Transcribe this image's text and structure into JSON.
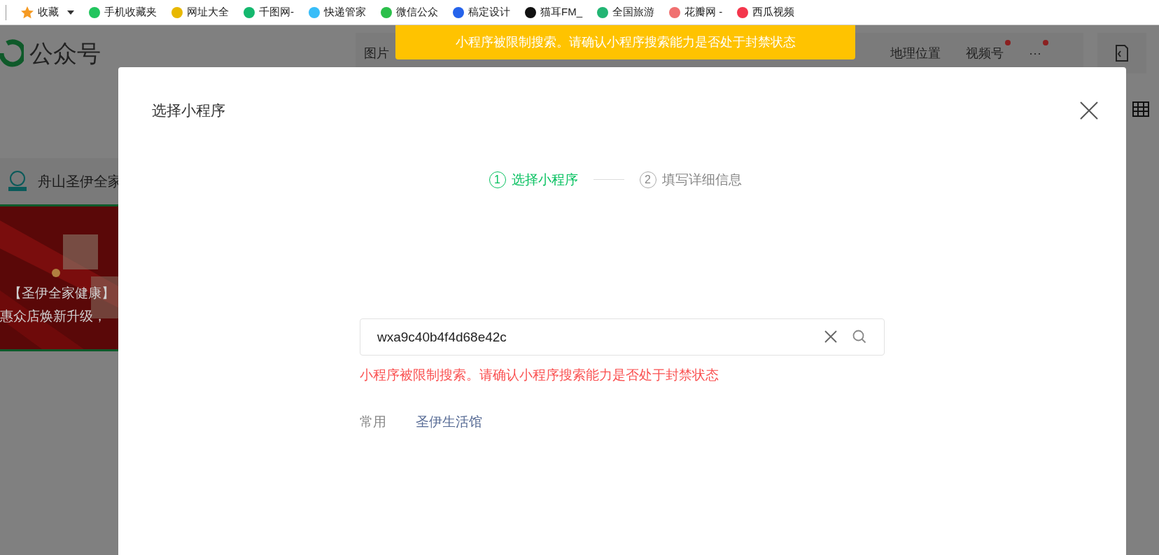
{
  "bookmarks": [
    {
      "label": "收藏",
      "color": "#f59a23"
    },
    {
      "label": "手机收藏夹",
      "color": "#22c55e"
    },
    {
      "label": "网址大全",
      "color": "#e8b800"
    },
    {
      "label": "千图网-",
      "color": "#14b86e"
    },
    {
      "label": "快递管家",
      "color": "#38bdf8"
    },
    {
      "label": "微信公众",
      "color": "#2bbf4a"
    },
    {
      "label": "稿定设计",
      "color": "#2563eb"
    },
    {
      "label": "猫耳FM_",
      "color": "#111111"
    },
    {
      "label": "全国旅游",
      "color": "#22b573"
    },
    {
      "label": "花瓣网 -",
      "color": "#f07070"
    },
    {
      "label": "西瓜视频",
      "color": "#f4364c"
    }
  ],
  "page": {
    "brand": "公众号",
    "nav": [
      "图片",
      "地理位置",
      "视频号",
      "···"
    ],
    "account": "舟山圣伊全家",
    "banner_lines": [
      "【圣伊全家健康】",
      "惠众店焕新升级，"
    ]
  },
  "toast": "小程序被限制搜索。请确认小程序搜索能力是否处于封禁状态",
  "dialog": {
    "title": "选择小程序",
    "steps": [
      {
        "number": "1",
        "label": "选择小程序",
        "selected": true
      },
      {
        "number": "2",
        "label": "填写详细信息",
        "selected": false
      }
    ],
    "search": {
      "value": "wxa9c40b4f4d68e42c"
    },
    "error": "小程序被限制搜索。请确认小程序搜索能力是否处于封禁状态",
    "recent": {
      "label": "常用",
      "items": [
        "圣伊生活馆"
      ]
    }
  }
}
